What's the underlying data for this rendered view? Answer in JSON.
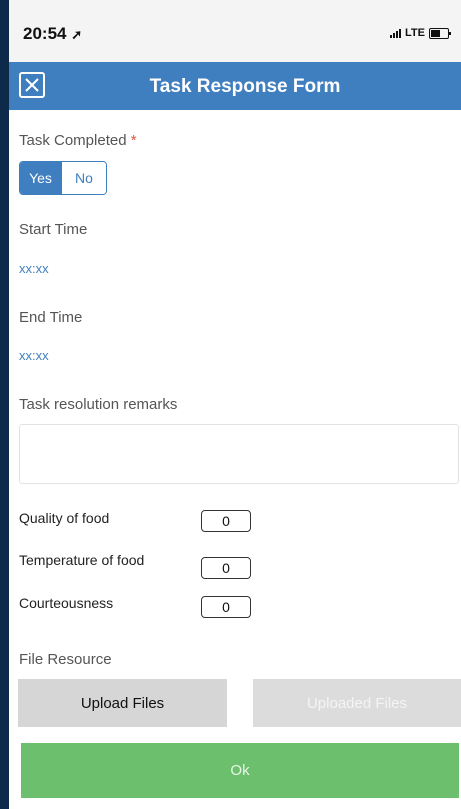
{
  "status": {
    "time": "20:54",
    "network": "LTE"
  },
  "header": {
    "title": "Task Response Form"
  },
  "form": {
    "task_completed_label": "Task Completed",
    "required_mark": "*",
    "yes_label": "Yes",
    "no_label": "No",
    "start_time_label": "Start Time",
    "start_time_value": "xx:xx",
    "end_time_label": "End Time",
    "end_time_value": "xx:xx",
    "remarks_label": "Task resolution remarks",
    "remarks_value": "",
    "ratings": [
      {
        "label": "Quality of food",
        "value": "0"
      },
      {
        "label": "Temperature of food",
        "value": "0"
      },
      {
        "label": "Courteousness",
        "value": "0"
      }
    ],
    "file_resource_label": "File Resource",
    "upload_button": "Upload Files",
    "uploaded_button": "Uploaded Files",
    "ok_button": "Ok"
  },
  "colors": {
    "accent": "#3f7fbf",
    "ok": "#6cbf6c",
    "required": "#e0563c"
  }
}
